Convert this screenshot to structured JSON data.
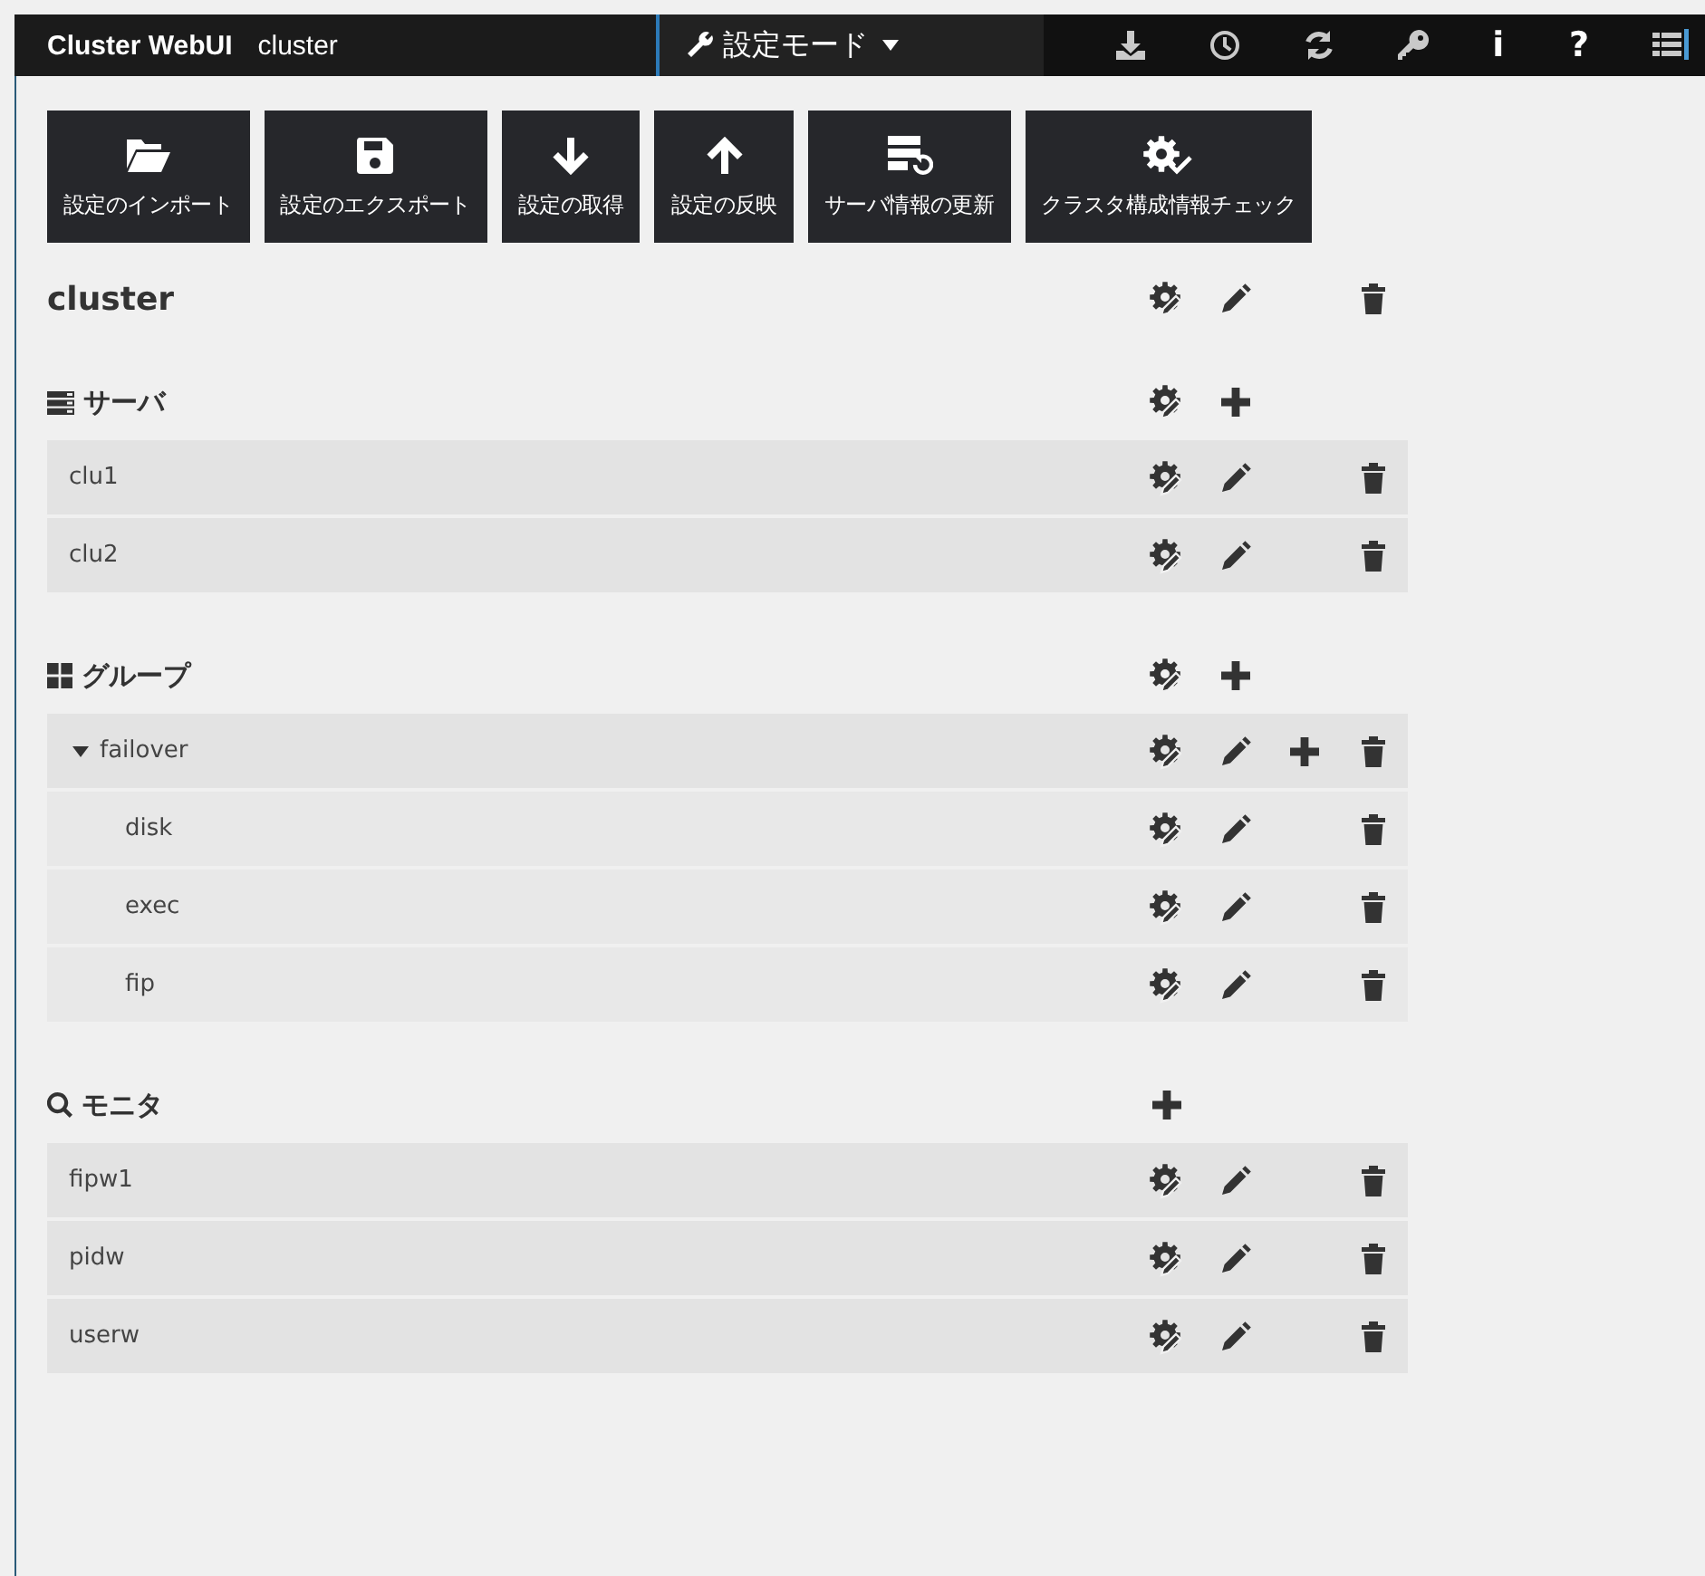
{
  "header": {
    "title": "Cluster WebUI",
    "cluster_name": "cluster",
    "mode": {
      "label": "設定モード"
    },
    "glyphs": [
      "i",
      "?"
    ]
  },
  "toolbar": [
    {
      "label": "設定のインポート"
    },
    {
      "label": "設定のエクスポート"
    },
    {
      "label": "設定の取得"
    },
    {
      "label": "設定の反映"
    },
    {
      "label": "サーバ情報の更新"
    },
    {
      "label": "クラスタ構成情報チェック"
    }
  ],
  "cluster": {
    "name": "cluster",
    "actions": {
      "properties": true,
      "edit": true,
      "add": false,
      "delete": true
    }
  },
  "sections": [
    {
      "title": "サーバ",
      "actions": {
        "properties": true,
        "add": true
      },
      "items": [
        {
          "name": "clu1",
          "actions": {
            "properties": true,
            "edit": true,
            "add": false,
            "delete": true
          }
        },
        {
          "name": "clu2",
          "actions": {
            "properties": true,
            "edit": true,
            "add": false,
            "delete": true
          }
        }
      ]
    },
    {
      "title": "グループ",
      "actions": {
        "properties": true,
        "add": true
      },
      "items": [
        {
          "name": "failover",
          "expanded": true,
          "actions": {
            "properties": true,
            "edit": true,
            "add": true,
            "delete": true
          },
          "children": [
            {
              "name": "disk",
              "actions": {
                "properties": true,
                "edit": true,
                "add": false,
                "delete": true
              }
            },
            {
              "name": "exec",
              "actions": {
                "properties": true,
                "edit": true,
                "add": false,
                "delete": true
              }
            },
            {
              "name": "fip",
              "actions": {
                "properties": true,
                "edit": true,
                "add": false,
                "delete": true
              }
            }
          ]
        }
      ]
    },
    {
      "title": "モニタ",
      "actions": {
        "properties": false,
        "add": true
      },
      "items": [
        {
          "name": "fipw1",
          "actions": {
            "properties": true,
            "edit": true,
            "add": false,
            "delete": true
          }
        },
        {
          "name": "pidw",
          "actions": {
            "properties": true,
            "edit": true,
            "add": false,
            "delete": true
          }
        },
        {
          "name": "userw",
          "actions": {
            "properties": true,
            "edit": true,
            "add": false,
            "delete": true
          }
        }
      ]
    }
  ]
}
